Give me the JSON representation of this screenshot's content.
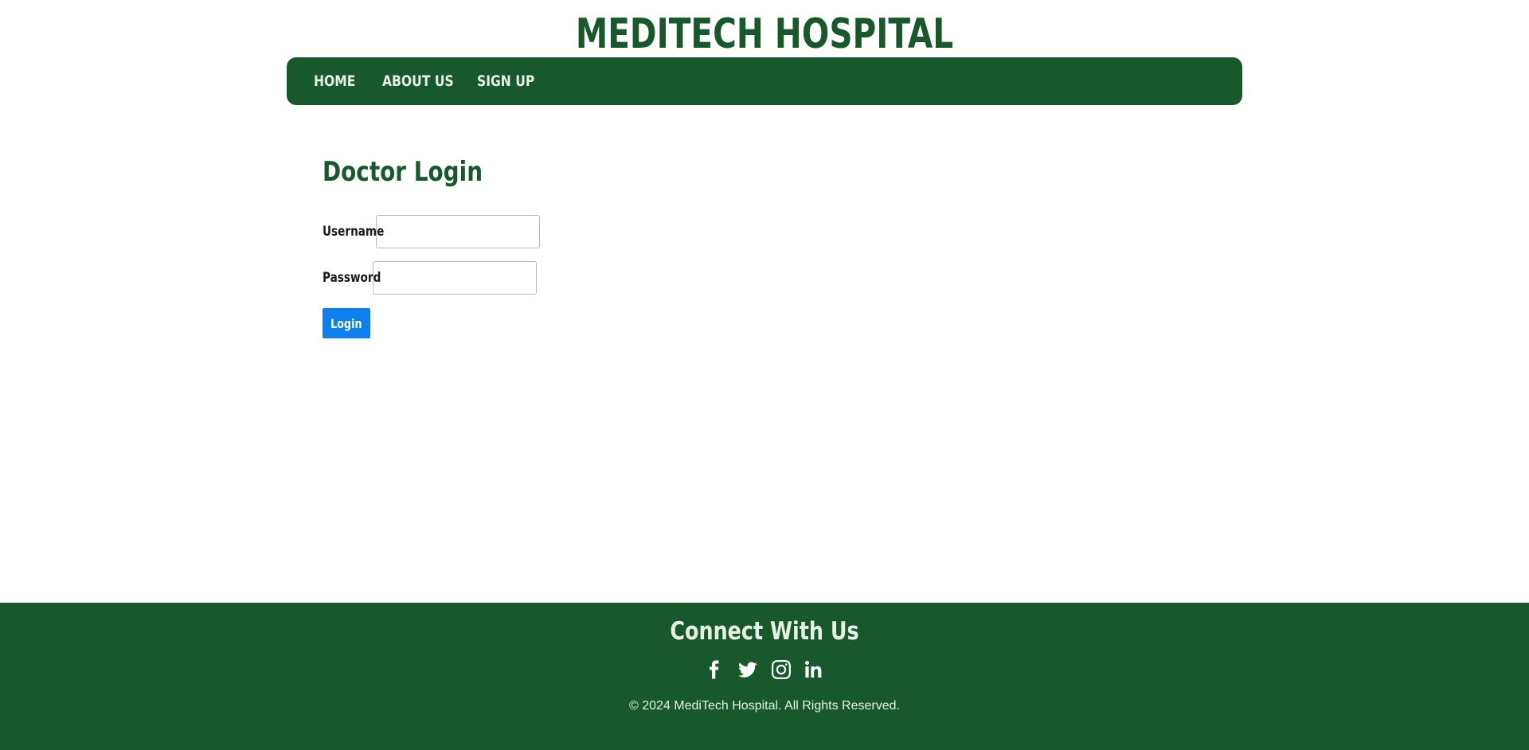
{
  "header": {
    "site_title": "MEDITECH HOSPITAL"
  },
  "nav": {
    "items": [
      {
        "label": "HOME"
      },
      {
        "label": "ABOUT US"
      },
      {
        "label": "SIGN UP"
      }
    ]
  },
  "login_form": {
    "title": "Doctor Login",
    "username_label": "Username",
    "username_value": "",
    "password_label": "Password",
    "password_value": "",
    "submit_label": "Login"
  },
  "footer": {
    "title": "Connect With Us",
    "social_icons": [
      "facebook-icon",
      "twitter-icon",
      "instagram-icon",
      "linkedin-icon"
    ],
    "copyright": "© 2024 MediTech Hospital. All Rights Reserved."
  },
  "colors": {
    "brand_green": "#17592a",
    "button_blue": "#0d7fee",
    "footer_text": "#e8f0e6"
  }
}
